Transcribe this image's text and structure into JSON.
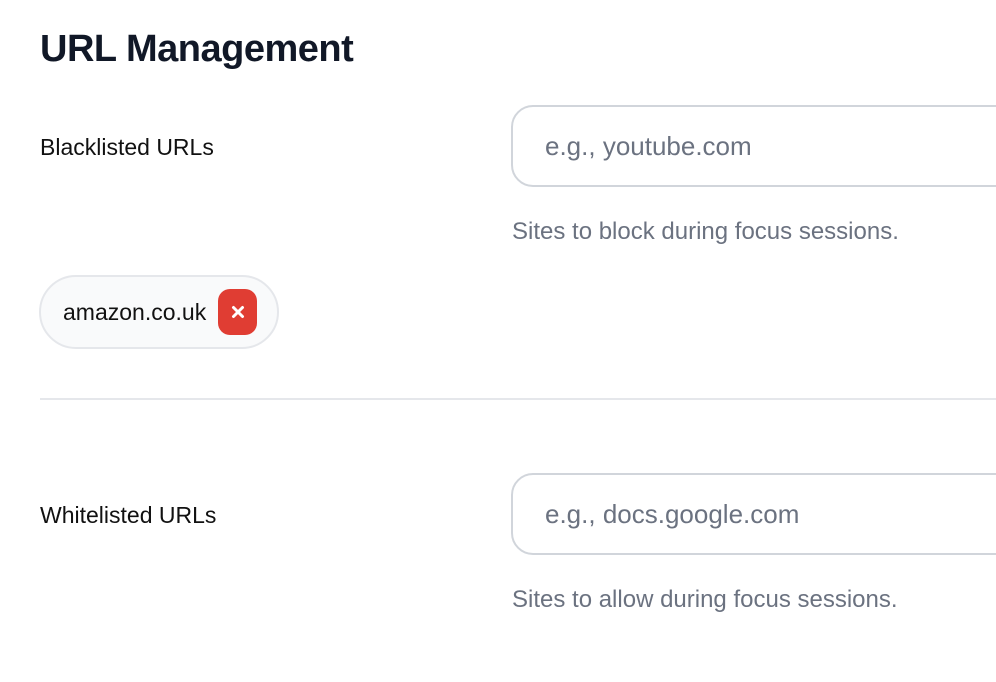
{
  "page": {
    "title": "URL Management"
  },
  "blacklist": {
    "label": "Blacklisted URLs",
    "input_placeholder": "e.g., youtube.com",
    "input_value": "",
    "help_text": "Sites to block during focus sessions.",
    "tags": [
      {
        "label": "amazon.co.uk",
        "remove_icon": "close-icon"
      }
    ]
  },
  "whitelist": {
    "label": "Whitelisted URLs",
    "input_placeholder": "e.g., docs.google.com",
    "input_value": "",
    "help_text": "Sites to allow during focus sessions."
  },
  "colors": {
    "title": "#111827",
    "muted_text": "#6b7280",
    "remove_button": "#e03d33",
    "input_border": "#d1d5db",
    "divider": "#e5e7eb"
  }
}
